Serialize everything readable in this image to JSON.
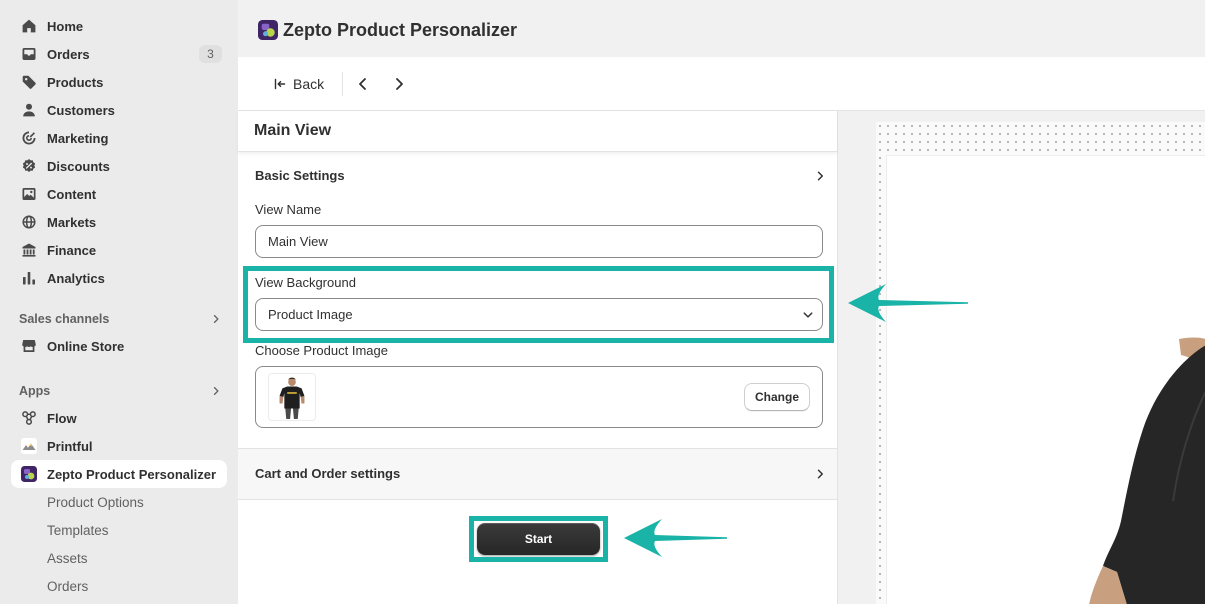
{
  "sidebar": {
    "nav": [
      {
        "label": "Home",
        "icon": "home-icon"
      },
      {
        "label": "Orders",
        "icon": "orders-icon",
        "badge": "3"
      },
      {
        "label": "Products",
        "icon": "tag-icon"
      },
      {
        "label": "Customers",
        "icon": "person-icon"
      },
      {
        "label": "Marketing",
        "icon": "target-icon"
      },
      {
        "label": "Discounts",
        "icon": "discount-icon"
      },
      {
        "label": "Content",
        "icon": "content-icon"
      },
      {
        "label": "Markets",
        "icon": "globe-icon"
      },
      {
        "label": "Finance",
        "icon": "bank-icon"
      },
      {
        "label": "Analytics",
        "icon": "bar-chart-icon"
      }
    ],
    "sales_channels": {
      "heading": "Sales channels",
      "items": [
        {
          "label": "Online Store",
          "icon": "store-icon"
        }
      ]
    },
    "apps": {
      "heading": "Apps",
      "items": [
        {
          "label": "Flow",
          "icon": "flow-icon"
        },
        {
          "label": "Printful",
          "icon": "printful-icon"
        },
        {
          "label": "Zepto Product Personalizer",
          "icon": "zepto-app-icon",
          "selected": true
        }
      ],
      "sub_items": [
        "Product Options",
        "Templates",
        "Assets",
        "Orders"
      ]
    }
  },
  "header": {
    "title": "Zepto Product Personalizer",
    "icon": "zepto-app-icon"
  },
  "toolbar": {
    "back_label": "Back",
    "back_icon": "back-arrow-icon",
    "prev_icon": "chevron-left-icon",
    "next_icon": "chevron-right-icon"
  },
  "panel": {
    "title": "Main View",
    "basic_settings": {
      "heading": "Basic Settings",
      "view_name": {
        "label": "View Name",
        "value": "Main View"
      },
      "view_background": {
        "label": "View Background",
        "value": "Product Image"
      },
      "product_image": {
        "label": "Choose Product Image",
        "change_label": "Change"
      }
    },
    "cart_order": {
      "heading": "Cart and Order settings"
    },
    "start_label": "Start"
  },
  "colors": {
    "annotation_teal": "#19b3a7",
    "primary_button": "#303030",
    "sidebar_bg": "#ebebeb",
    "selected_item_bg": "#ffffff"
  }
}
